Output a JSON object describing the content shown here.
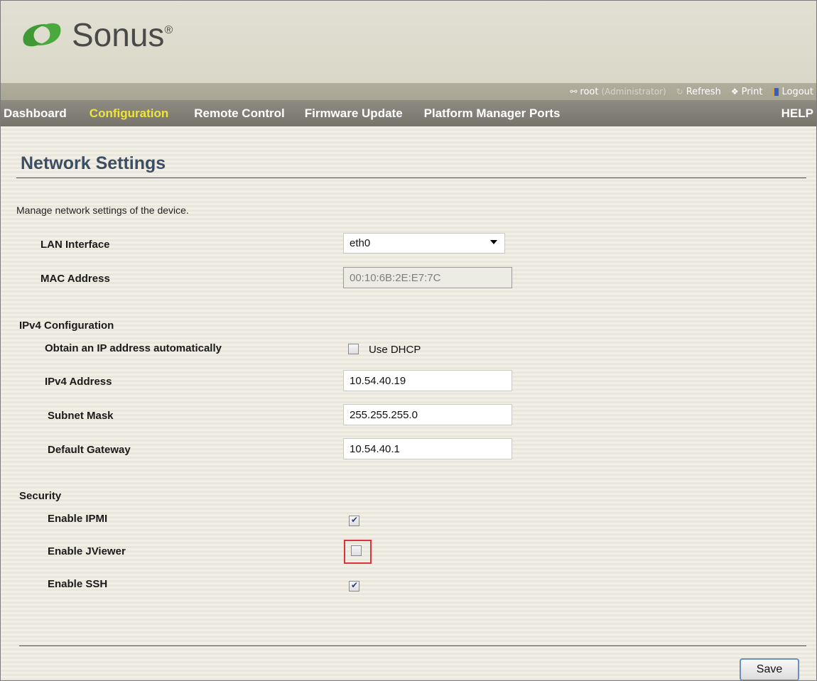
{
  "brand": {
    "name": "Sonus",
    "reg_mark": "®"
  },
  "utility": {
    "user": "root",
    "role": "(Administrator)",
    "refresh": "Refresh",
    "print": "Print",
    "logout": "Logout"
  },
  "nav": {
    "items": [
      {
        "label": "Dashboard",
        "active": false
      },
      {
        "label": "Configuration",
        "active": true
      },
      {
        "label": "Remote Control",
        "active": false
      },
      {
        "label": "Firmware Update",
        "active": false
      },
      {
        "label": "Platform Manager Ports",
        "active": false
      }
    ],
    "help": "HELP"
  },
  "page": {
    "title": "Network Settings",
    "description": "Manage network settings of the device."
  },
  "lan": {
    "interface_label": "LAN Interface",
    "interface_value": "eth0",
    "mac_label": "MAC Address",
    "mac_value": "00:10:6B:2E:E7:7C"
  },
  "ipv4": {
    "section_label": "IPv4 Configuration",
    "dhcp_label": "Obtain an IP address automatically",
    "dhcp_checkbox_label": "Use DHCP",
    "dhcp_checked": false,
    "address_label": "IPv4 Address",
    "address_value": "10.54.40.19",
    "subnet_label": "Subnet Mask",
    "subnet_value": "255.255.255.0",
    "gateway_label": "Default Gateway",
    "gateway_value": "10.54.40.1"
  },
  "security": {
    "section_label": "Security",
    "ipmi_label": "Enable IPMI",
    "ipmi_checked": true,
    "jviewer_label": "Enable JViewer",
    "jviewer_checked": false,
    "ssh_label": "Enable SSH",
    "ssh_checked": true
  },
  "actions": {
    "save": "Save"
  },
  "colors": {
    "active_nav": "#f0e33a",
    "title": "#3d4d62",
    "highlight": "#e0303c"
  }
}
